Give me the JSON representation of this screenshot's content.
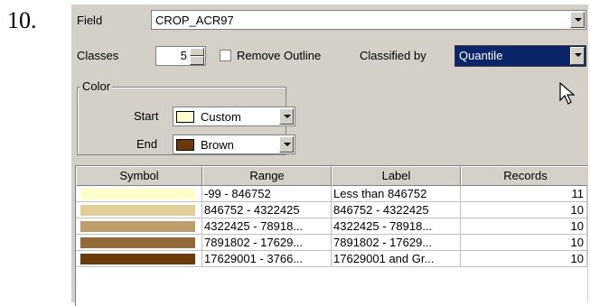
{
  "step_number": "10.",
  "field": {
    "label": "Field",
    "value": "CROP_ACR97"
  },
  "classes": {
    "label": "Classes",
    "value": "5"
  },
  "remove_outline": {
    "label": "Remove Outline",
    "checked": false
  },
  "classified_by": {
    "label": "Classified by",
    "value": "Quantile"
  },
  "color_group": {
    "title": "Color",
    "start": {
      "label": "Start",
      "value": "Custom",
      "swatch": "#ffffcc"
    },
    "end": {
      "label": "End",
      "value": "Brown",
      "swatch": "#6b3a0a"
    }
  },
  "table": {
    "headers": [
      "Symbol",
      "Range",
      "Label",
      "Records"
    ],
    "rows": [
      {
        "color": "#ffffcc",
        "range": "-99 - 846752",
        "label": "Less than 846752",
        "records": "11"
      },
      {
        "color": "#e0cf99",
        "range": "846752 - 4322425",
        "label": "846752 - 4322425",
        "records": "10"
      },
      {
        "color": "#bd9e6c",
        "range": "4322425 - 78918...",
        "label": "4322425 - 78918...",
        "records": "10"
      },
      {
        "color": "#94693a",
        "range": "7891802 - 17629...",
        "label": "7891802 - 17629...",
        "records": "10"
      },
      {
        "color": "#6b3a0a",
        "range": "17629001 - 3766...",
        "label": "17629001 and Gr...",
        "records": "10"
      }
    ]
  }
}
